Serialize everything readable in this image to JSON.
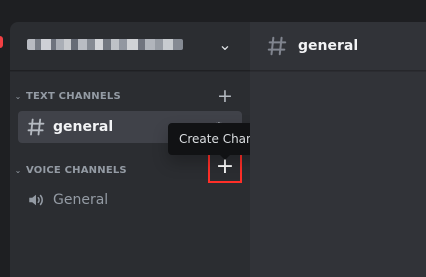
{
  "colors": {
    "app_background": "#1e1f22",
    "sidebar_background": "#2b2d31",
    "main_background": "#313338",
    "selected_channel_background": "#404249",
    "tooltip_background": "#111214",
    "highlight_red": "#ff2f28"
  },
  "server": {
    "name_redacted": true,
    "dropdown_icon": "chevron-down-icon"
  },
  "sidebar": {
    "text_section": {
      "label": "TEXT CHANNELS",
      "add_icon": "plus-icon",
      "channels": [
        {
          "label": "general",
          "icon": "hash-icon",
          "selected": true
        }
      ]
    },
    "voice_section": {
      "label": "VOICE CHANNELS",
      "add_icon": "plus-icon",
      "channels": [
        {
          "label": "General",
          "icon": "speaker-icon",
          "selected": false
        }
      ]
    }
  },
  "tooltip": {
    "text": "Create Channel"
  },
  "main": {
    "channel_title": "general",
    "title_icon": "hash-icon"
  }
}
